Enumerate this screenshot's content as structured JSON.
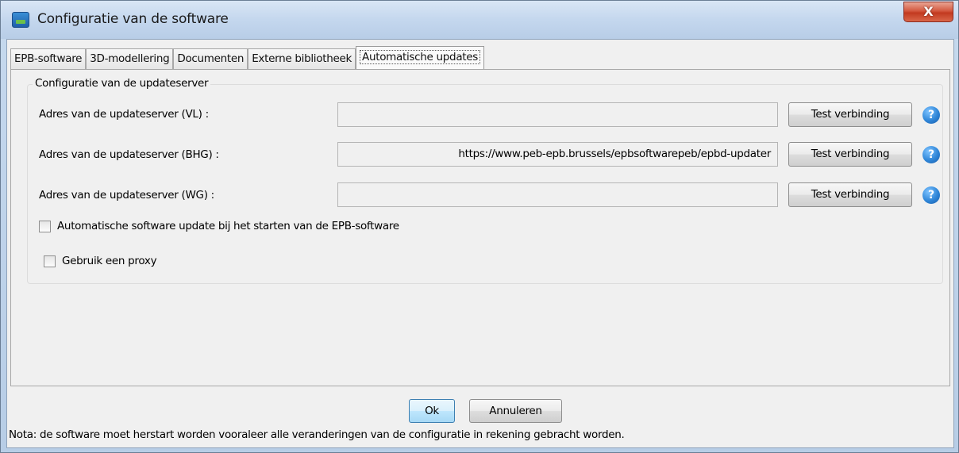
{
  "window": {
    "title": "Configuratie van de software",
    "close_label": "X"
  },
  "tabs": [
    {
      "label": "EPB-software",
      "active": false
    },
    {
      "label": "3D-modellering",
      "active": false
    },
    {
      "label": "Documenten",
      "active": false
    },
    {
      "label": "Externe bibliotheek",
      "active": false
    },
    {
      "label": "Automatische updates",
      "active": true
    }
  ],
  "group": {
    "title": "Configuratie van de updateserver",
    "rows": [
      {
        "label": "Adres van de updateserver (VL) :",
        "value": "",
        "button": "Test verbinding"
      },
      {
        "label": "Adres van de updateserver (BHG) :",
        "value": "https://www.peb-epb.brussels/epbsoftwarepeb/epbd-updater",
        "button": "Test verbinding"
      },
      {
        "label": "Adres van de updateserver (WG) :",
        "value": "",
        "button": "Test verbinding"
      }
    ],
    "help_glyph": "?",
    "checkboxes": [
      {
        "label": "Automatische software update bij het starten van de EPB-software",
        "checked": false
      },
      {
        "label": "Gebruik een proxy",
        "checked": false
      }
    ]
  },
  "footer": {
    "ok_label": "Ok",
    "cancel_label": "Annuleren",
    "note": "Nota: de software moet herstart worden vooraleer alle veranderingen van de configuratie in rekening gebracht worden."
  },
  "colors": {
    "titlebar": "#c4d7ee",
    "close_button": "#c23a20",
    "help_icon": "#2f86d8",
    "ok_button": "#bee6fd"
  },
  "icons": {
    "app": "app-icon",
    "help": "help-icon",
    "close": "close-icon"
  }
}
